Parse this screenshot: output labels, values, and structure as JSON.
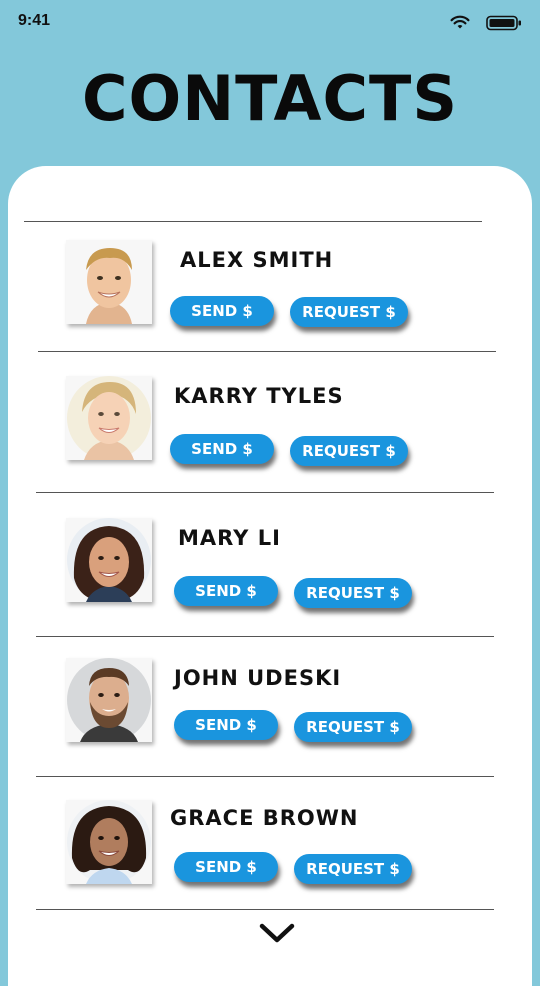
{
  "status_bar": {
    "time": "9:41",
    "icons": [
      "wifi-icon",
      "battery-icon"
    ]
  },
  "header": {
    "title": "CONTACTS"
  },
  "contacts": [
    {
      "name": "ALEX SMITH",
      "send_label": "SEND $",
      "request_label": "REQUEST $",
      "avatar": "avatar-photo-alex-smith"
    },
    {
      "name": "KARRY TYLES",
      "send_label": "SEND $",
      "request_label": "REQUEST $",
      "avatar": "avatar-photo-karry-tyles"
    },
    {
      "name": "MARY LI",
      "send_label": "SEND $",
      "request_label": "REQUEST $",
      "avatar": "avatar-photo-mary-li"
    },
    {
      "name": "JOHN UDESKI",
      "send_label": "SEND $",
      "request_label": "REQUEST $",
      "avatar": "avatar-photo-john-udeski"
    },
    {
      "name": "GRACE BROWN",
      "send_label": "SEND $",
      "request_label": "REQUEST $",
      "avatar": "avatar-photo-grace-brown"
    }
  ],
  "footer": {
    "more_icon": "chevron-down-icon"
  },
  "colors": {
    "background": "#83c8da",
    "card": "#ffffff",
    "button": "#1a95de",
    "button_text": "#ffffff",
    "title_text": "#0a0a0a"
  }
}
